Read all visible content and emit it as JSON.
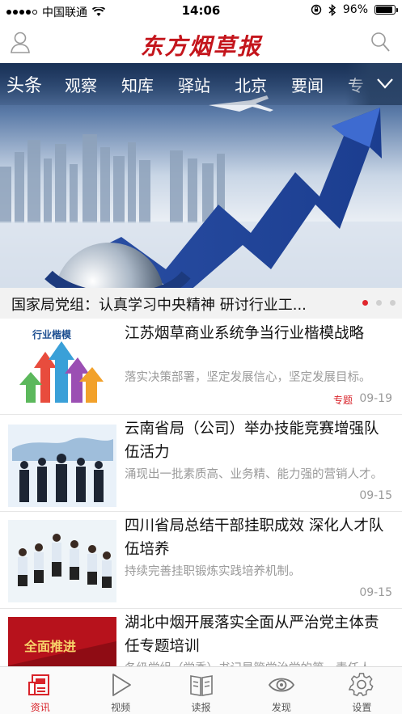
{
  "status_bar": {
    "carrier": "中国联通",
    "time": "14:06",
    "battery": "96%",
    "battery_level": 0.96
  },
  "header": {
    "logo": "东方烟草报"
  },
  "tabs": [
    {
      "label": "头条"
    },
    {
      "label": "观察"
    },
    {
      "label": "知库"
    },
    {
      "label": "驿站"
    },
    {
      "label": "北京"
    },
    {
      "label": "要闻"
    },
    {
      "label": "专"
    }
  ],
  "banner": {
    "caption": "国家局党组：认真学习中央精神 研讨行业工...",
    "pages": 3,
    "current_page": 1
  },
  "news": [
    {
      "title": "江苏烟草商业系统争当行业楷模战略",
      "summary": "落实决策部署，坚定发展信心，坚定发展目标。",
      "tag": "专题",
      "date": "09-19",
      "thumb_text": "行业楷模"
    },
    {
      "title": "云南省局（公司）举办技能竞赛增强队伍活力",
      "summary": "涌现出一批素质高、业务精、能力强的营销人才。",
      "tag": "",
      "date": "09-15",
      "thumb_text": ""
    },
    {
      "title": "四川省局总结干部挂职成效 深化人才队伍培养",
      "summary": "持续完善挂职锻炼实践培养机制。",
      "tag": "",
      "date": "09-15",
      "thumb_text": ""
    },
    {
      "title": "湖北中烟开展落实全面从严治党主体责任专题培训",
      "summary": "各级党组（党委）书记是管党治党的第一责任人",
      "tag": "",
      "date": "",
      "thumb_text": "全面推进"
    }
  ],
  "bottom_nav": [
    {
      "label": "资讯",
      "icon": "news-icon",
      "active": true
    },
    {
      "label": "视频",
      "icon": "play-icon",
      "active": false
    },
    {
      "label": "读报",
      "icon": "newspaper-icon",
      "active": false
    },
    {
      "label": "发现",
      "icon": "eye-icon",
      "active": false
    },
    {
      "label": "设置",
      "icon": "gear-icon",
      "active": false
    }
  ],
  "colors": {
    "brand_red": "#c4151c",
    "active_nav": "#d9232a"
  }
}
